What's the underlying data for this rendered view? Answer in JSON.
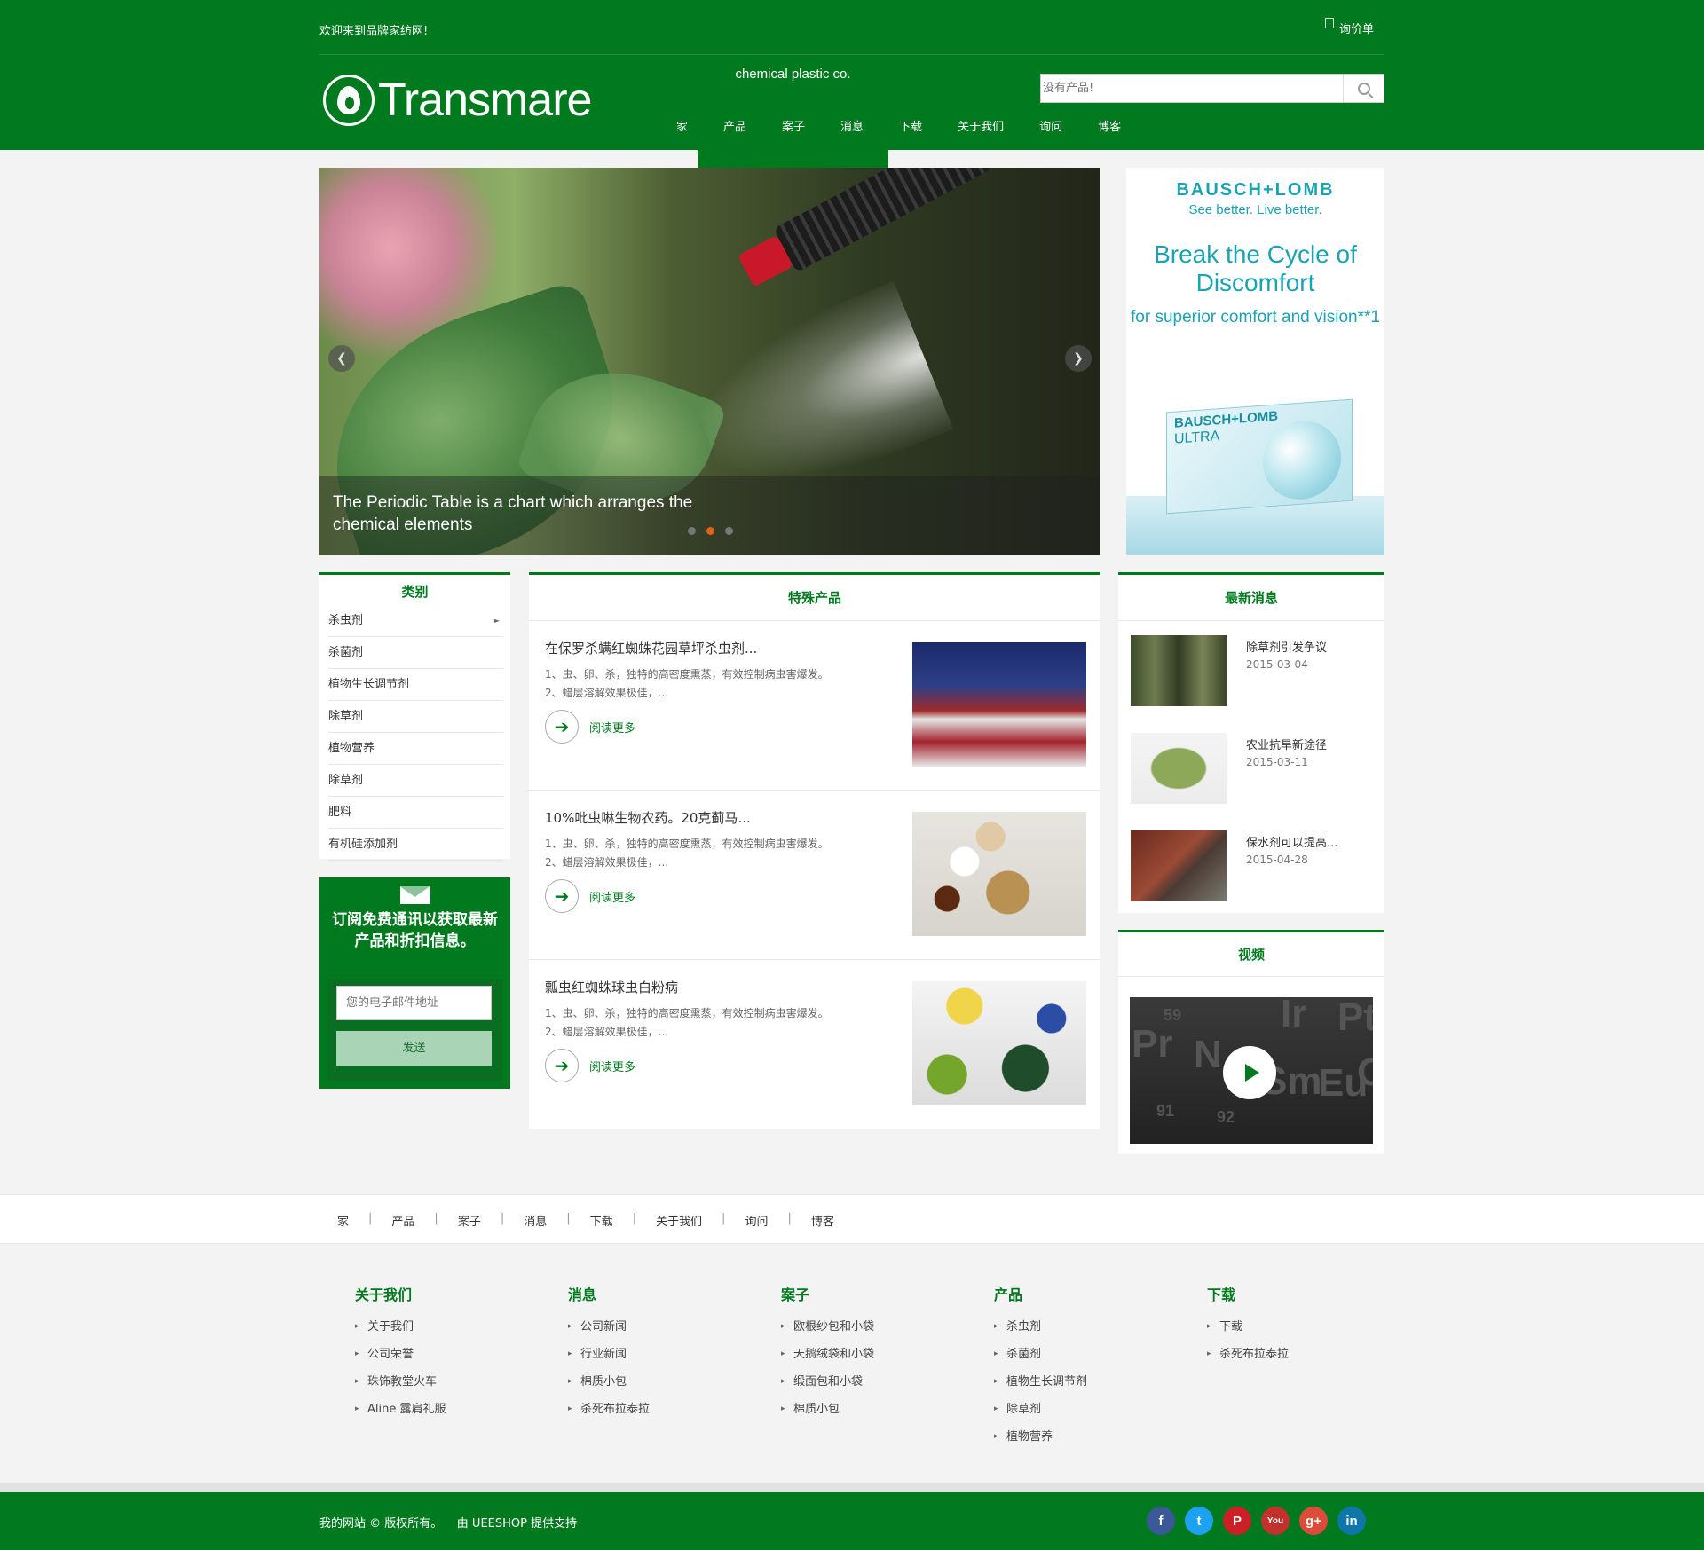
{
  "header": {
    "welcome": "欢迎来到品牌家纺网!",
    "inquiry": "询价单",
    "logo_brand": "Transmare",
    "logo_sub": "chemical plastic co.",
    "search_placeholder": "没有产品!",
    "nav": [
      "家",
      "产品",
      "案子",
      "消息",
      "下载",
      "关于我们",
      "询问",
      "博客"
    ]
  },
  "slider": {
    "caption": "The Periodic Table is a chart which arranges the chemical elements",
    "prev_icon": "chevron-left-icon",
    "next_icon": "chevron-right-icon",
    "dots": 3,
    "active_dot": 2
  },
  "ad": {
    "brand": "BAUSCH+LOMB",
    "tagline": "See better. Live better.",
    "headline": "Break the Cycle of Discomfort",
    "sub": "for superior comfort and vision**1",
    "box_brand": "BAUSCH+LOMB",
    "box_product": "ULTRA"
  },
  "category": {
    "title": "类别",
    "items": [
      "杀虫剂",
      "杀菌剂",
      "植物生长调节剂",
      "除草剂",
      "植物营养",
      "除草剂",
      "肥料",
      "有机硅添加剂"
    ]
  },
  "subscribe": {
    "title": "订阅免费通讯以获取最新产品和折扣信息。",
    "email_placeholder": "您的电子邮件地址",
    "button": "发送"
  },
  "products": {
    "title": "特殊产品",
    "items": [
      {
        "title": "在保罗杀螨红蜘蛛花园草坪杀虫剂...",
        "desc1": "1、虫、卵、杀，独特的高密度熏蒸，有效控制病虫害爆发。",
        "desc2": "2、蜡层溶解效果极佳，...",
        "more": "阅读更多"
      },
      {
        "title": "10%吡虫啉生物农药。20克蓟马...",
        "desc1": "1、虫、卵、杀，独特的高密度熏蒸，有效控制病虫害爆发。",
        "desc2": "2、蜡层溶解效果极佳，...",
        "more": "阅读更多"
      },
      {
        "title": "瓢虫红蜘蛛球虫白粉病",
        "desc1": "1、虫、卵、杀，独特的高密度熏蒸，有效控制病虫害爆发。",
        "desc2": "2、蜡层溶解效果极佳，...",
        "more": "阅读更多"
      }
    ]
  },
  "news": {
    "title": "最新消息",
    "items": [
      {
        "title": "除草剂引发争议",
        "date": "2015-03-04"
      },
      {
        "title": "农业抗旱新途径",
        "date": "2015-03-11"
      },
      {
        "title": "保水剂可以提高...",
        "date": "2015-04-28"
      }
    ]
  },
  "video": {
    "title": "视频",
    "tiles": [
      "59",
      "Pr",
      "N",
      "Sm",
      "Eu",
      "G",
      "91",
      "92",
      "Ir",
      "Pt"
    ]
  },
  "footer_nav": [
    "家",
    "产品",
    "案子",
    "消息",
    "下载",
    "关于我们",
    "询问",
    "博客"
  ],
  "footer_cols": [
    {
      "title": "关于我们",
      "items": [
        "关于我们",
        "公司荣誉",
        "珠饰教堂火车",
        "Aline 露肩礼服"
      ]
    },
    {
      "title": "消息",
      "items": [
        "公司新闻",
        "行业新闻",
        "棉质小包",
        "杀死布拉泰拉"
      ]
    },
    {
      "title": "案子",
      "items": [
        "欧根纱包和小袋",
        "天鹅绒袋和小袋",
        "缎面包和小袋",
        "棉质小包"
      ]
    },
    {
      "title": "产品",
      "items": [
        "杀虫剂",
        "杀菌剂",
        "植物生长调节剂",
        "除草剂",
        "植物营养"
      ]
    },
    {
      "title": "下载",
      "items": [
        "下载",
        "杀死布拉泰拉"
      ]
    }
  ],
  "footer": {
    "copyright": "我的网站 © 版权所有。",
    "powered": "由 UEESHOP 提供支持",
    "social": [
      {
        "name": "facebook-icon",
        "glyph": "f",
        "color": "#3b5998"
      },
      {
        "name": "twitter-icon",
        "glyph": "t",
        "color": "#1da1f2"
      },
      {
        "name": "pinterest-icon",
        "glyph": "P",
        "color": "#cb2027"
      },
      {
        "name": "youtube-icon",
        "glyph": "You",
        "color": "#c4302b"
      },
      {
        "name": "google-plus-icon",
        "glyph": "g+",
        "color": "#dd4b39"
      },
      {
        "name": "linkedin-icon",
        "glyph": "in",
        "color": "#0e76a8"
      }
    ]
  }
}
